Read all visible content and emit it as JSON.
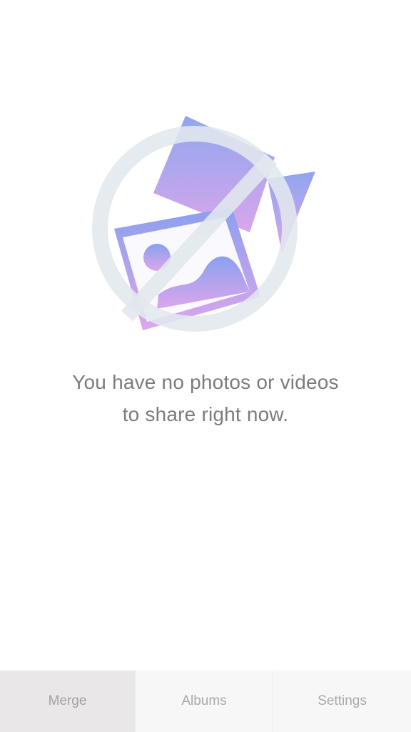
{
  "empty_state": {
    "icon": "no-photos-videos-icon",
    "line1": "You have no photos or videos",
    "line2": "to share right now."
  },
  "tabs": [
    {
      "label": "Merge",
      "active": true
    },
    {
      "label": "Albums",
      "active": false
    },
    {
      "label": "Settings",
      "active": false
    }
  ],
  "colors": {
    "gradient_top": "#8fa6ef",
    "gradient_bottom": "#d9a6ec",
    "prohibit_ring": "#e3e8ee",
    "active_tab_bg": "#e9e7e8",
    "tab_bg": "#f7f7f7",
    "text": "#7c7c7c"
  }
}
